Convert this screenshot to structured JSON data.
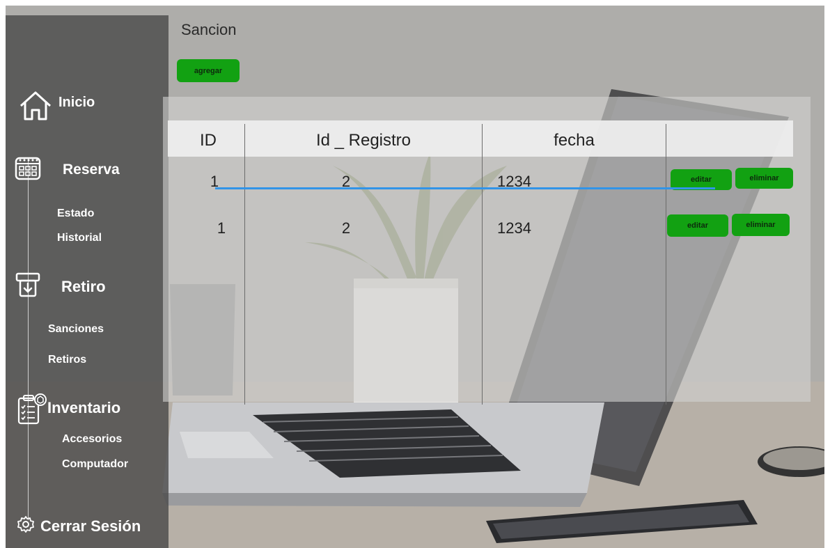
{
  "page": {
    "title": "Sancion"
  },
  "actions": {
    "add_label": "agregar"
  },
  "sidebar": {
    "items": [
      {
        "label": "Inicio",
        "icon": "home-icon"
      },
      {
        "label": "Reserva",
        "icon": "calendar-icon",
        "subitems": [
          "Estado",
          "Historial"
        ]
      },
      {
        "label": "Retiro",
        "icon": "withdraw-tray-icon",
        "subitems": [
          "Sanciones",
          "Retiros"
        ]
      },
      {
        "label": "Inventario",
        "icon": "inventory-clipboard-icon",
        "subitems": [
          "Accesorios",
          "Computador"
        ]
      }
    ],
    "logout": {
      "label": "Cerrar Sesión",
      "icon": "gear-icon"
    }
  },
  "table": {
    "columns": [
      "ID",
      "Id _ Registro",
      "fecha",
      ""
    ],
    "rows": [
      {
        "id": "1",
        "id_registro": "2",
        "fecha": "1234",
        "edit_label": "editar",
        "delete_label": "eliminar"
      },
      {
        "id": "1",
        "id_registro": "2",
        "fecha": "1234",
        "edit_label": "editar",
        "delete_label": "eliminar"
      }
    ]
  },
  "colors": {
    "button_green": "#12a112",
    "sidebar_bg": "#484848",
    "strike_line": "#3194e8"
  }
}
